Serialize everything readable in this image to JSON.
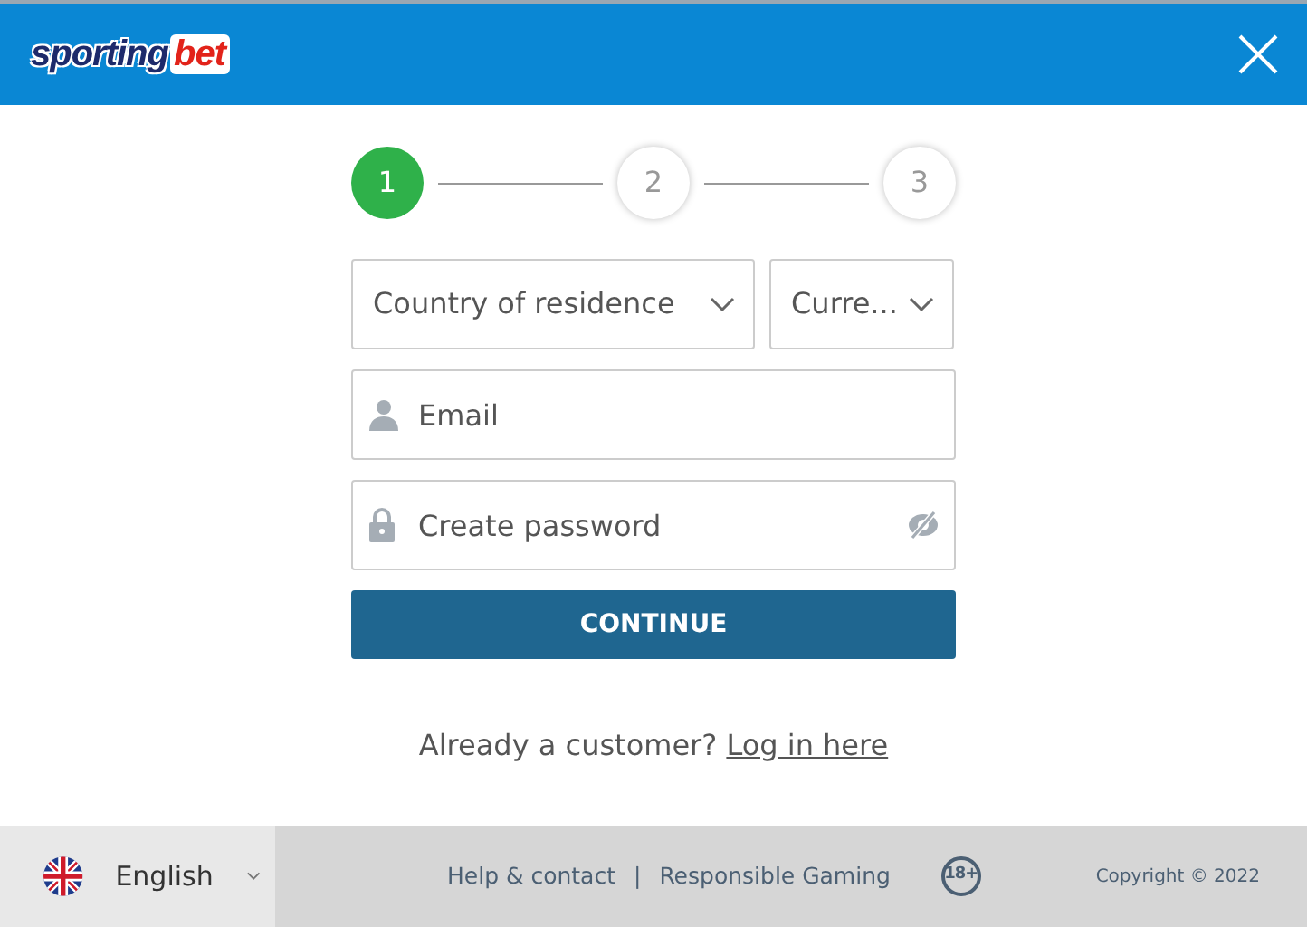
{
  "header": {
    "logo": {
      "part_1": "sporting",
      "part_2": "bet"
    }
  },
  "steps": [
    {
      "label": "1",
      "selected": true
    },
    {
      "label": "2",
      "selected": false
    },
    {
      "label": "3",
      "selected": false
    }
  ],
  "selects": [
    {
      "placeholder": "Country of residence"
    },
    {
      "placeholder": "Curre..."
    }
  ],
  "fields": [
    {
      "kind": "email",
      "placeholder": "Email"
    },
    {
      "kind": "password",
      "placeholder": "Create password"
    }
  ],
  "continue_button": "CONTINUE",
  "login_prompt": {
    "text": "Already a customer?",
    "link": "Log in here"
  },
  "footer": {
    "language": "English",
    "links": [
      "Help & contact",
      "Responsible Gaming"
    ],
    "separator": "|",
    "age_badge": "18+",
    "copyright": "Copyright © 2022"
  }
}
